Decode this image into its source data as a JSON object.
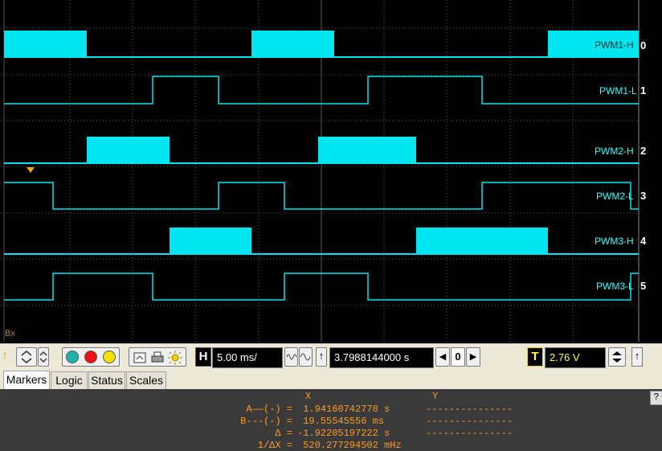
{
  "scope": {
    "corner_label": "Bx",
    "colors": {
      "trace": "#00e5ef",
      "grid": "#5a5a5a",
      "marker": "#f5a623",
      "background": "#000000"
    },
    "channels": [
      {
        "name": "PWM1-H",
        "number": "0",
        "style": "bus",
        "edges": [
          0,
          108,
          313,
          416,
          682,
          795
        ],
        "start_high": true
      },
      {
        "name": "PWM1-L",
        "number": "1",
        "style": "line",
        "edges": [
          190,
          272,
          458,
          600
        ],
        "start_high": false
      },
      {
        "name": "PWM2-H",
        "number": "2",
        "style": "bus",
        "edges": [
          108,
          211,
          396,
          518
        ],
        "start_high": false
      },
      {
        "name": "PWM2-L",
        "number": "3",
        "style": "line",
        "edges": [
          66,
          272,
          354,
          600,
          785
        ],
        "start_high": true
      },
      {
        "name": "PWM3-H",
        "number": "4",
        "style": "bus",
        "edges": [
          211,
          313,
          518,
          682
        ],
        "start_high": false
      },
      {
        "name": "PWM3-L",
        "number": "5",
        "style": "line",
        "edges": [
          66,
          190,
          354,
          458,
          785
        ],
        "start_high": false
      }
    ]
  },
  "toolbar": {
    "h_label": "H",
    "timebase": "5.00 ms/",
    "cursor_time": "3.7988144000 s",
    "step_value": "0",
    "t_label": "T",
    "trigger_level": "2.76 V",
    "up_arrow": "↑",
    "left_arrow": "◀",
    "right_arrow": "▶"
  },
  "tabs": [
    "Markers",
    "Logic",
    "Status",
    "Scales"
  ],
  "markers": {
    "col_x": "X",
    "col_y": "Y",
    "help": "?",
    "rows": [
      {
        "label": "A——(-) =",
        "value": " 1.94160742778 s",
        "y": "---------------"
      },
      {
        "label": "B---(-) =",
        "value": " 19.55545556 ms",
        "y": "---------------"
      },
      {
        "label": "Δ =",
        "value": "-1.92205197222 s",
        "y": "---------------"
      },
      {
        "label": "1/ΔX =",
        "value": " 520.277294502 mHz",
        "y": ""
      }
    ]
  }
}
